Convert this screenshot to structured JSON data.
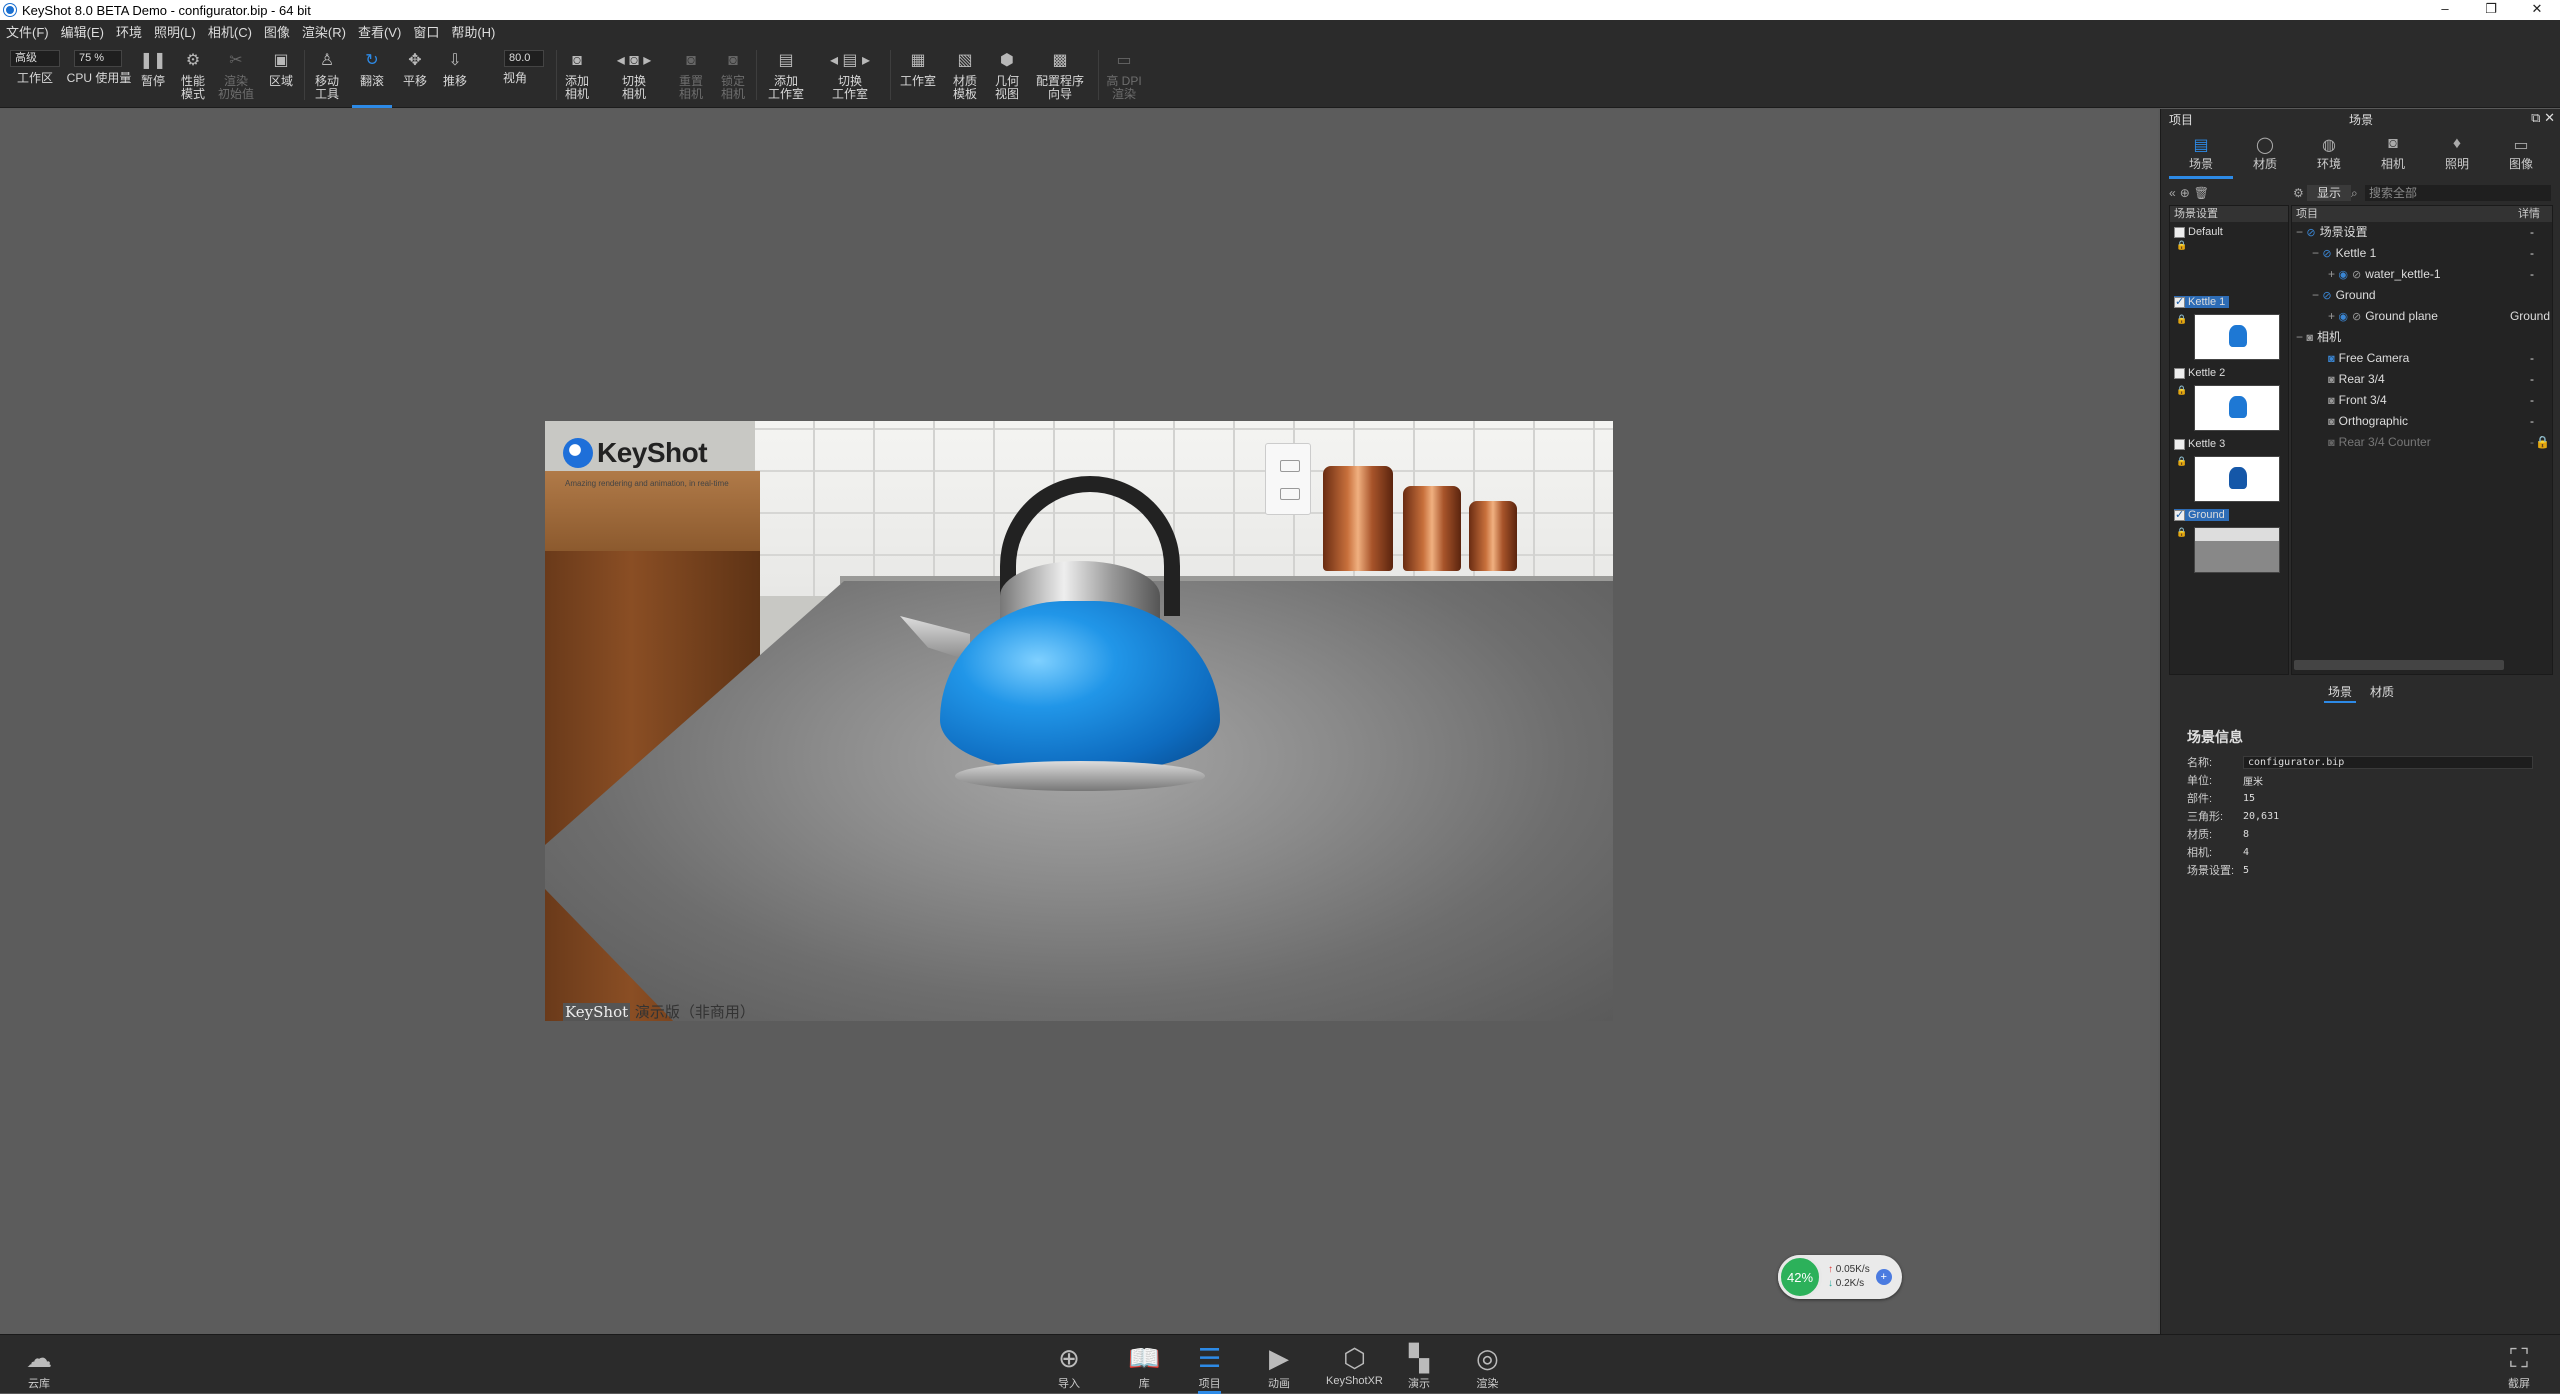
{
  "window": {
    "title": "KeyShot 8.0 BETA Demo  - configurator.bip - 64 bit",
    "minimize": "–",
    "maximize": "❐",
    "close": "✕"
  },
  "menu": [
    "文件(F)",
    "编辑(E)",
    "环境",
    "照明(L)",
    "相机(C)",
    "图像",
    "渲染(R)",
    "查看(V)",
    "窗口",
    "帮助(H)"
  ],
  "toolbar": {
    "workspace_select": "高级",
    "cpu_usage_value": "75 %",
    "fov_value": "80.0",
    "items": [
      {
        "label": "工作区",
        "icon": "workspace-icon"
      },
      {
        "label": "CPU 使用量",
        "icon": "cpu-icon"
      },
      {
        "label": "暂停",
        "icon": "pause-icon"
      },
      {
        "label": "性能\n模式",
        "icon": "performance-icon"
      },
      {
        "label": "渲染\n初始值",
        "icon": "render-initial-icon"
      },
      {
        "label": "区域",
        "icon": "region-icon"
      },
      {
        "label": "移动\n工具",
        "icon": "move-tool-icon"
      },
      {
        "label": "翻滚",
        "icon": "tumble-icon"
      },
      {
        "label": "平移",
        "icon": "pan-icon"
      },
      {
        "label": "推移",
        "icon": "dolly-icon"
      },
      {
        "label": "视角",
        "icon": "fov-icon"
      },
      {
        "label": "添加\n相机",
        "icon": "add-camera-icon"
      },
      {
        "label": "切换\n相机",
        "icon": "switch-camera-icon"
      },
      {
        "label": "重置\n相机",
        "icon": "reset-camera-icon"
      },
      {
        "label": "锁定\n相机",
        "icon": "lock-camera-icon"
      },
      {
        "label": "添加\n工作室",
        "icon": "add-studio-icon"
      },
      {
        "label": "切换\n工作室",
        "icon": "switch-studio-icon"
      },
      {
        "label": "工作室",
        "icon": "studio-icon"
      },
      {
        "label": "材质\n模板",
        "icon": "material-template-icon"
      },
      {
        "label": "几何\n视图",
        "icon": "geometry-view-icon"
      },
      {
        "label": "配置程序\n向导",
        "icon": "configurator-wizard-icon"
      },
      {
        "label": "高 DPI\n渲染",
        "icon": "high-dpi-icon"
      }
    ]
  },
  "render": {
    "logo_text": "KeyShot",
    "logo_tagline": "Amazing rendering and animation, in real-time",
    "watermark_keyshot": "KeyShot",
    "watermark_rest": " 演示版（非商用）"
  },
  "net_widget": {
    "percent": "42%",
    "up": "0.05K/s",
    "down": "0.2K/s",
    "plus": "+"
  },
  "panel": {
    "left_title": "项目",
    "center_title": "场景",
    "tabs": [
      {
        "label": "场景",
        "icon": "scene-icon",
        "active": true
      },
      {
        "label": "材质",
        "icon": "material-icon",
        "active": false
      },
      {
        "label": "环境",
        "icon": "environment-icon",
        "active": false
      },
      {
        "label": "相机",
        "icon": "camera-icon",
        "active": false
      },
      {
        "label": "照明",
        "icon": "lighting-icon",
        "active": false
      },
      {
        "label": "图像",
        "icon": "image-icon",
        "active": false
      }
    ],
    "show_button": "显示",
    "search_placeholder": "搜索全部",
    "sets_header": "场景设置",
    "tree_header_item": "项目",
    "tree_header_detail": "详情",
    "scene_sets": [
      {
        "name": "Default",
        "checked": false,
        "thumb": "none"
      },
      {
        "name": "Kettle 1",
        "checked": true,
        "thumb": "kettle"
      },
      {
        "name": "Kettle 2",
        "checked": false,
        "thumb": "kettle"
      },
      {
        "name": "Kettle 3",
        "checked": false,
        "thumb": "kettle"
      },
      {
        "name": "Ground",
        "checked": true,
        "thumb": "ground"
      }
    ],
    "tree": [
      {
        "label": "场景设置",
        "detail": "-",
        "indent": 0,
        "dim": false
      },
      {
        "label": "Kettle 1",
        "detail": "-",
        "indent": 1,
        "dim": false
      },
      {
        "label": "water_kettle-1",
        "detail": "-",
        "indent": 2,
        "dim": false
      },
      {
        "label": "Ground",
        "detail": "",
        "indent": 1,
        "dim": false
      },
      {
        "label": "Ground plane",
        "detail": "Ground",
        "indent": 2,
        "dim": false
      },
      {
        "label": "相机",
        "detail": "",
        "indent": 0,
        "dim": false
      },
      {
        "label": "Free Camera",
        "detail": "-",
        "indent": 1,
        "dim": false
      },
      {
        "label": "Rear 3/4",
        "detail": "-",
        "indent": 1,
        "dim": false
      },
      {
        "label": "Front 3/4",
        "detail": "-",
        "indent": 1,
        "dim": false
      },
      {
        "label": "Orthographic",
        "detail": "-",
        "indent": 1,
        "dim": false
      },
      {
        "label": "Rear 3/4 Counter",
        "detail": "-",
        "indent": 1,
        "dim": true
      }
    ],
    "sub_tabs": [
      "场景",
      "材质"
    ],
    "info": {
      "title": "场景信息",
      "rows": [
        {
          "k": "名称:",
          "v": "configurator.bip"
        },
        {
          "k": "单位:",
          "v": "厘米"
        },
        {
          "k": "部件:",
          "v": "15"
        },
        {
          "k": "三角形:",
          "v": "20,631"
        },
        {
          "k": "材质:",
          "v": "8"
        },
        {
          "k": "相机:",
          "v": "4"
        },
        {
          "k": "场景设置:",
          "v": "5"
        }
      ]
    }
  },
  "bottombar": {
    "cloud": "云库",
    "fullscreen": "截屏",
    "items": [
      {
        "label": "导入",
        "icon": "import-icon",
        "active": false
      },
      {
        "label": "库",
        "icon": "library-icon",
        "active": false
      },
      {
        "label": "项目",
        "icon": "project-icon",
        "active": true
      },
      {
        "label": "动画",
        "icon": "animation-icon",
        "active": false
      },
      {
        "label": "KeyShotXR",
        "icon": "keyshotxr-icon",
        "active": false
      },
      {
        "label": "演示",
        "icon": "presentation-icon",
        "active": false
      },
      {
        "label": "渲染",
        "icon": "render-icon",
        "active": false
      }
    ]
  },
  "colors": {
    "accent": "#2d8ae6",
    "panel_bg": "#2b2b2b",
    "viewport_bg": "#5c5c5c"
  }
}
